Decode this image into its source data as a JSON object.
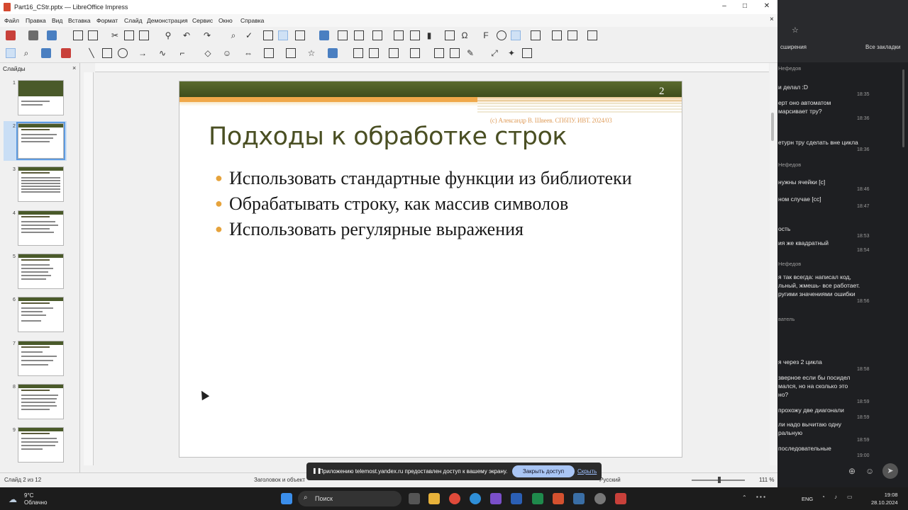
{
  "window": {
    "title": "Part16_CStr.pptx — LibreOffice Impress",
    "minimize": "–",
    "maximize": "□",
    "close": "✕"
  },
  "menu": [
    "Файл",
    "Правка",
    "Вид",
    "Вставка",
    "Формат",
    "Слайд",
    "Демонстрация",
    "Сервис",
    "Окно",
    "Справка"
  ],
  "slides_pane": {
    "title": "Слайды",
    "close": "×",
    "count": 9,
    "selected": 2
  },
  "slide": {
    "number": "2",
    "copyright": "(с) Александр В. Швеев. СПбПУ. ИВТ. 2024/03",
    "heading": "Подходы к обработке строк",
    "bullets": [
      "Использовать стандартные функции из библиотеки",
      "Обрабатывать строку, как массив символов",
      "Использовать регулярные выражения"
    ],
    "bullet_color": "#e6a33c"
  },
  "status": {
    "slide_info": "Слайд 2 из 12",
    "layout": "Заголовок и объект",
    "lang": "Русский",
    "zoom": "111 %"
  },
  "share_notice": {
    "message": "Приложению telemost.yandex.ru предоставлен доступ к вашему экрану.",
    "stop": "Закрыть доступ",
    "hide": "Скрыть"
  },
  "browser": {
    "bookmarks_a": "сширения",
    "bookmarks_b": "Все закладки"
  },
  "chat": [
    {
      "kind": "name",
      "text": "Нефедов"
    },
    {
      "kind": "msg",
      "text": "и делал :D",
      "time": "18:35"
    },
    {
      "kind": "msg",
      "text": "ерт оно автоматом",
      "time": ""
    },
    {
      "kind": "msg",
      "text": "марсивает тру?",
      "time": "18:36"
    },
    {
      "kind": "msg",
      "text": "етурн тру сделать вне цикла",
      "time": "18:36"
    },
    {
      "kind": "name",
      "text": "Нефедов"
    },
    {
      "kind": "msg",
      "text": "нужны ячейки [с]",
      "time": "18:46"
    },
    {
      "kind": "msg",
      "text": "ном случае [сс]",
      "time": "18:47"
    },
    {
      "kind": "msg",
      "text": "ость",
      "time": "18:53"
    },
    {
      "kind": "msg",
      "text": "ия же квадратный",
      "time": "18:54"
    },
    {
      "kind": "name",
      "text": "Нефедов"
    },
    {
      "kind": "msg",
      "text": "я так всегда: написал код,",
      "time": ""
    },
    {
      "kind": "msg",
      "text": "льный, жмешь- все работает.",
      "time": ""
    },
    {
      "kind": "msg",
      "text": "ругими значениями ошибки",
      "time": "18:56"
    },
    {
      "kind": "name",
      "text": "ватель"
    },
    {
      "kind": "msg",
      "text": "я через 2 цикла",
      "time": "18:58"
    },
    {
      "kind": "msg",
      "text": "зверное если бы посидел",
      "time": ""
    },
    {
      "kind": "msg",
      "text": "мался, но на сколько это",
      "time": ""
    },
    {
      "kind": "msg",
      "text": "но?",
      "time": "18:59"
    },
    {
      "kind": "msg",
      "text": "прохожу две диагонали",
      "time": "18:59"
    },
    {
      "kind": "msg",
      "text": "ли надо вычитаю одну",
      "time": ""
    },
    {
      "kind": "msg",
      "text": "ральную",
      "time": "18:59"
    },
    {
      "kind": "msg",
      "text": "последовательные",
      "time": "19:00"
    }
  ],
  "taskbar": {
    "temp": "9°C",
    "weather": "Облачно",
    "search": "Поиск",
    "lang": "ENG",
    "time": "19:08",
    "date": "28.10.2024"
  }
}
